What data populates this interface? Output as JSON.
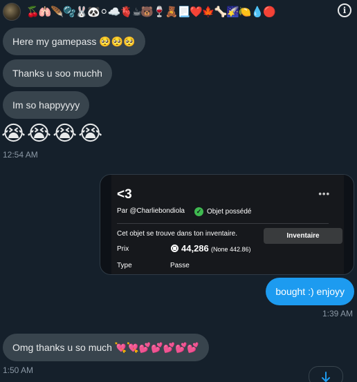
{
  "header": {
    "emoji_strip": "🍒🫁🪶🫧🐰🐼⚪☁️🫀☕🐻🍷🧸📃❤️🍁🦴🌠🍋💧🔴",
    "avatar_icon": "group-avatar",
    "info_icon": "info-circle-icon",
    "info_glyph": "i"
  },
  "messages": [
    {
      "text": "Here my gamepass 🥺🥺🥺",
      "direction": "incoming"
    },
    {
      "text": "Thanks u soo muchh",
      "direction": "incoming"
    },
    {
      "text": "Im so happyyyy",
      "direction": "incoming"
    },
    {
      "text": "😭😭😭😭",
      "direction": "incoming"
    },
    {
      "text": "bought :) enjoyy",
      "direction": "outgoing"
    },
    {
      "text": "Omg thanks u so much 💘💘💕💕💕💕💕",
      "direction": "incoming"
    }
  ],
  "timestamps": {
    "t1": "12:54 AM",
    "t2": "1:39 AM",
    "t3": "1:50 AM"
  },
  "card": {
    "title": "<3",
    "more": "•••",
    "by": "Par @Charliebondiola",
    "check_glyph": "✓",
    "owned": "Objet possédé",
    "description": "Cet objet se trouve dans ton inventaire.",
    "inventory_button": "Inventaire",
    "price_label": "Prix",
    "price": "44,286",
    "price_note": "(None 442.86)",
    "type_label": "Type",
    "type_value": "Passe"
  },
  "colors": {
    "background": "#15202b",
    "incoming_bubble": "#38444d",
    "outgoing_bubble": "#1d9bf0"
  },
  "scroll": {
    "icon": "arrow-down-icon"
  }
}
